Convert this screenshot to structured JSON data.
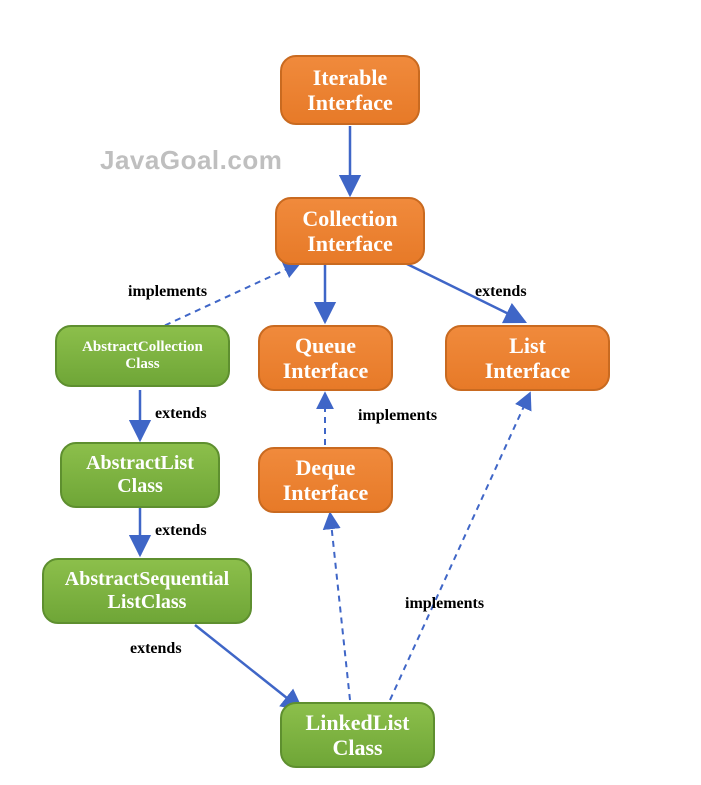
{
  "watermark": "JavaGoal.com",
  "nodes": {
    "iterable": {
      "line1": "Iterable",
      "line2": "Interface"
    },
    "collection": {
      "line1": "Collection",
      "line2": "Interface"
    },
    "queue": {
      "line1": "Queue",
      "line2": "Interface"
    },
    "list": {
      "line1": "List",
      "line2": "Interface"
    },
    "deque": {
      "line1": "Deque",
      "line2": "Interface"
    },
    "abscoll": {
      "line1": "AbstractCollection",
      "line2": "Class"
    },
    "abslist": {
      "line1": "AbstractList",
      "line2": "Class"
    },
    "absseq": {
      "line1": "AbstractSequential",
      "line2": "ListClass"
    },
    "linked": {
      "line1": "LinkedList",
      "line2": "Class"
    }
  },
  "labels": {
    "implements1": "implements",
    "extends1": "extends",
    "extends2": "extends",
    "implements2": "implements",
    "extends3": "extends",
    "extends4": "extends",
    "implements3": "implements"
  },
  "chart_data": {
    "type": "diagram",
    "title": "Java LinkedList class hierarchy",
    "nodes": [
      {
        "id": "Iterable",
        "kind": "interface"
      },
      {
        "id": "Collection",
        "kind": "interface"
      },
      {
        "id": "Queue",
        "kind": "interface"
      },
      {
        "id": "List",
        "kind": "interface"
      },
      {
        "id": "Deque",
        "kind": "interface"
      },
      {
        "id": "AbstractCollection",
        "kind": "class"
      },
      {
        "id": "AbstractList",
        "kind": "class"
      },
      {
        "id": "AbstractSequentialList",
        "kind": "class"
      },
      {
        "id": "LinkedList",
        "kind": "class"
      }
    ],
    "edges": [
      {
        "from": "Collection",
        "to": "Iterable",
        "relation": "extends"
      },
      {
        "from": "AbstractCollection",
        "to": "Collection",
        "relation": "implements"
      },
      {
        "from": "Queue",
        "to": "Collection",
        "relation": "extends"
      },
      {
        "from": "List",
        "to": "Collection",
        "relation": "extends"
      },
      {
        "from": "AbstractList",
        "to": "AbstractCollection",
        "relation": "extends"
      },
      {
        "from": "Deque",
        "to": "Queue",
        "relation": "implements"
      },
      {
        "from": "AbstractSequentialList",
        "to": "AbstractList",
        "relation": "extends"
      },
      {
        "from": "LinkedList",
        "to": "AbstractSequentialList",
        "relation": "extends"
      },
      {
        "from": "LinkedList",
        "to": "Deque",
        "relation": "implements"
      },
      {
        "from": "LinkedList",
        "to": "List",
        "relation": "implements"
      }
    ]
  }
}
